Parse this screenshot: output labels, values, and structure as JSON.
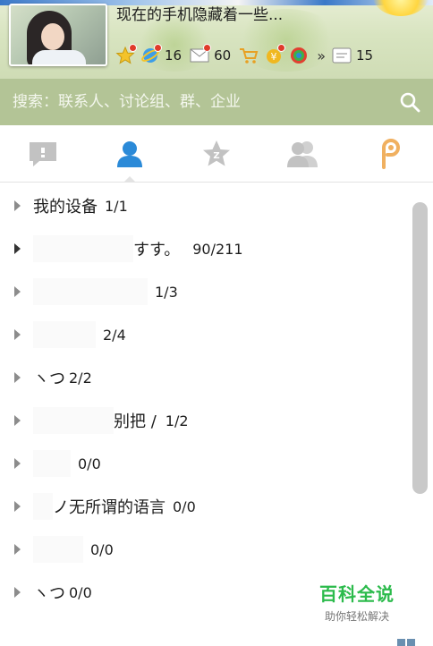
{
  "profile": {
    "signature": "现在的手机隐藏着一些..."
  },
  "status_icons": [
    {
      "icon": "star-icon",
      "count": null
    },
    {
      "icon": "qzone-icon",
      "count": "16"
    },
    {
      "icon": "mail-icon",
      "count": "60"
    },
    {
      "icon": "cart-icon",
      "count": null
    },
    {
      "icon": "wallet-icon",
      "count": null
    },
    {
      "icon": "apps-icon",
      "count": null
    }
  ],
  "more_label": "»",
  "message_icon_count": "15",
  "search": {
    "placeholder": "搜索：联系人、讨论组、群、企业"
  },
  "tabs": [
    {
      "icon": "message-icon",
      "active": false
    },
    {
      "icon": "contacts-icon",
      "active": true
    },
    {
      "icon": "favorites-icon",
      "active": false
    },
    {
      "icon": "groups-icon",
      "active": false
    },
    {
      "icon": "qzone-p-icon",
      "active": false
    }
  ],
  "groups": [
    {
      "name": "我的设备",
      "count": "1/1",
      "expanded": false
    },
    {
      "name": "すす。",
      "count": "90/211",
      "expanded": true
    },
    {
      "name": "",
      "count": "1/3",
      "expanded": false
    },
    {
      "name": "",
      "count": "2/4",
      "expanded": false
    },
    {
      "name": "ヽつ",
      "count": "2/2",
      "expanded": false
    },
    {
      "name": "别把 /",
      "count": "1/2",
      "expanded": false
    },
    {
      "name": "",
      "count": "0/0",
      "expanded": false
    },
    {
      "name": "ノ无所谓的语言",
      "count": "0/0",
      "expanded": false
    },
    {
      "name": "",
      "count": "0/0",
      "expanded": false
    },
    {
      "name": "ヽつ",
      "count": "0/0",
      "expanded": false
    }
  ],
  "watermark": {
    "title": "百科全说",
    "subtitle": "助你轻松解决"
  },
  "colors": {
    "accent_blue": "#2b8ad8",
    "search_bg": "#b3c496",
    "tab_gray": "#c2c2c2",
    "tab_orange": "#f0b060",
    "watermark_green": "#2cbb4c"
  }
}
